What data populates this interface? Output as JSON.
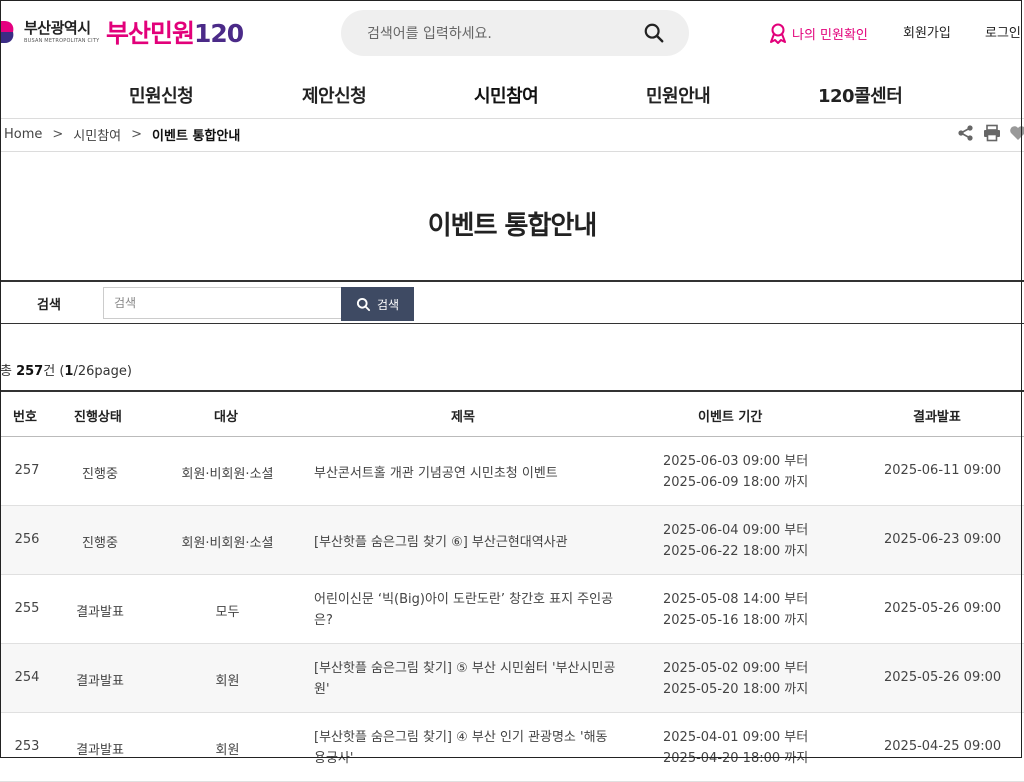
{
  "header": {
    "city_name": "부산광역시",
    "city_sub": "BUSAN METROPOLITAN CITY",
    "brand_part1": "부산민원",
    "brand_part2": "120",
    "search_placeholder": "검색어를 입력하세요.",
    "my_check": "나의 민원확인",
    "join": "회원가입",
    "login": "로그인"
  },
  "nav": {
    "items": [
      "민원신청",
      "제안신청",
      "시민참여",
      "민원안내",
      "120콜센터"
    ],
    "active": "시민참여"
  },
  "breadcrumb": {
    "home": "Home",
    "sep": ">",
    "level1": "시민참여",
    "current": "이벤트 통합안내"
  },
  "page_title": "이벤트 통합안내",
  "search": {
    "label": "검색",
    "placeholder": "검색",
    "button": "검색"
  },
  "total": {
    "prefix": "총 ",
    "count": "257",
    "unit": "건 (",
    "page": "1",
    "pages": "/26page)"
  },
  "table": {
    "headers": {
      "num": "번호",
      "status": "진행상태",
      "target": "대상",
      "title": "제목",
      "period": "이벤트 기간",
      "result": "결과발표"
    },
    "rows": [
      {
        "num": "257",
        "status": "진행중",
        "target": "회원·비회원·소셜",
        "title": "부산콘서트홀 개관 기념공연 시민초청 이벤트",
        "start": "2025-06-03 09:00 부터",
        "end": "2025-06-09 18:00 까지",
        "result": "2025-06-11 09:00"
      },
      {
        "num": "256",
        "status": "진행중",
        "target": "회원·비회원·소셜",
        "title": "[부산핫플 숨은그림 찾기 ⑥] 부산근현대역사관",
        "start": "2025-06-04 09:00 부터",
        "end": "2025-06-22 18:00 까지",
        "result": "2025-06-23 09:00"
      },
      {
        "num": "255",
        "status": "결과발표",
        "target": "모두",
        "title": "어린이신문 ‘빅(Big)아이 도란도란’ 창간호 표지 주인공은?",
        "start": "2025-05-08 14:00 부터",
        "end": "2025-05-16 18:00 까지",
        "result": "2025-05-26 09:00"
      },
      {
        "num": "254",
        "status": "결과발표",
        "target": "회원",
        "title": "[부산핫플 숨은그림 찾기] ⑤ 부산 시민쉼터 '부산시민공원'",
        "start": "2025-05-02 09:00 부터",
        "end": "2025-05-20 18:00 까지",
        "result": "2025-05-26 09:00"
      },
      {
        "num": "253",
        "status": "결과발표",
        "target": "회원",
        "title": "[부산핫플 숨은그림 찾기] ④ 부산 인기 관광명소 '해동용궁사'",
        "start": "2025-04-01 09:00 부터",
        "end": "2025-04-20 18:00 까지",
        "result": "2025-04-25 09:00"
      }
    ]
  },
  "icons": [
    "share-icon",
    "print-icon",
    "heart-icon",
    "search-icon",
    "person-ribbon-icon"
  ],
  "colors": {
    "brand_pink": "#e2007a",
    "brand_purple": "#4b2a88",
    "search_button": "#3e4a63"
  }
}
